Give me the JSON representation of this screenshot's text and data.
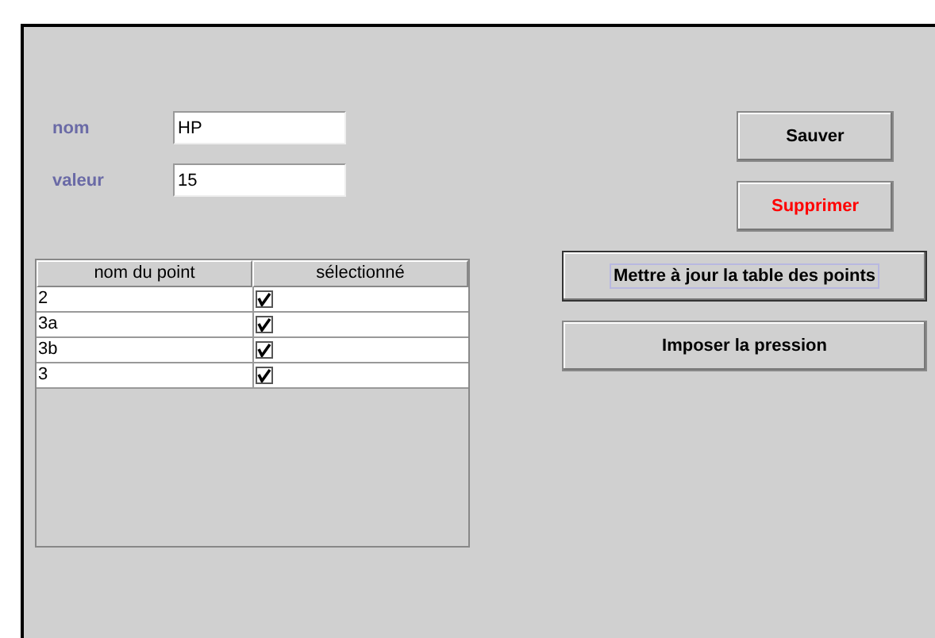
{
  "fields": [
    {
      "label": "nom",
      "value": "HP"
    },
    {
      "label": "valeur",
      "value": "15"
    }
  ],
  "table": {
    "columns": [
      "nom du point",
      "sélectionné"
    ],
    "rows": [
      {
        "name": "2",
        "checked": true
      },
      {
        "name": "3a",
        "checked": true
      },
      {
        "name": "3b",
        "checked": true
      },
      {
        "name": "3",
        "checked": true
      }
    ]
  },
  "small_buttons": [
    {
      "label": "Sauver",
      "color": "#000000",
      "focused": false
    },
    {
      "label": "Supprimer",
      "color": "#ff0000",
      "focused": false
    }
  ],
  "wide_buttons": [
    {
      "label": "Mettre à jour la table des points",
      "focused": true
    },
    {
      "label": "Imposer la pression",
      "focused": false
    }
  ]
}
